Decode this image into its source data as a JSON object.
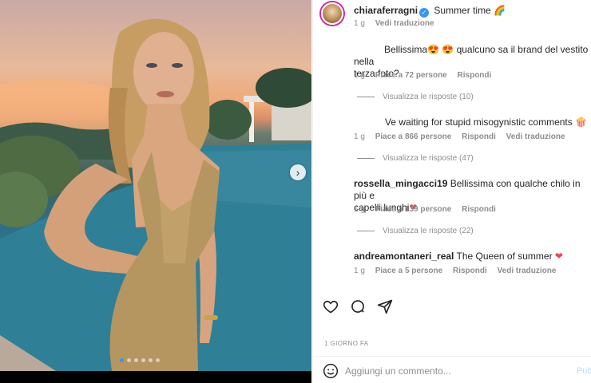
{
  "post": {
    "username": "chiaraferragni",
    "caption": "Summer time",
    "caption_emoji": "🌈",
    "age": "1 g",
    "translate": "Vedi traduzione",
    "timestamp": "1 GIORNO FA"
  },
  "comments": [
    {
      "text_prefix": "Bellissima",
      "emoji": "😍 😍",
      "text": "qualcuno sa il brand del vestito nella",
      "text_line2": "terza foto?",
      "age": "1 g",
      "likes": "Piace a 72 persone",
      "reply": "Rispondi",
      "view_replies": "Visualizza le risposte (10)"
    },
    {
      "text": "Ve waiting for stupid misogynistic comments",
      "emoji": "🍿",
      "age": "1 g",
      "likes": "Piace a 866 persone",
      "reply": "Rispondi",
      "translate": "Vedi traduzione",
      "view_replies": "Visualizza le risposte (47)"
    },
    {
      "username": "rossella_mingacci19",
      "text": "Bellissima con qualche chilo in più e",
      "text_line2": "capelli lunghi",
      "emoji": "❤",
      "age": "1 g",
      "likes": "Piace a 139 persone",
      "reply": "Rispondi",
      "view_replies": "Visualizza le risposte (22)"
    },
    {
      "username": "andreamontaneri_real",
      "text": "The Queen of summer",
      "emoji": "❤",
      "age": "1 g",
      "likes": "Piace a 5 persone",
      "reply": "Rispondi",
      "translate": "Vedi traduzione"
    }
  ],
  "composer": {
    "placeholder": "Aggiungi un commento...",
    "publish": "Pub"
  },
  "carousel": {
    "next_glyph": "›",
    "dots": 6,
    "active_dot": 0
  },
  "icons": {
    "avatar": "profile-avatar",
    "verified": "verified-badge-icon",
    "like": "heart-icon",
    "comment": "comment-bubble-icon",
    "share": "paper-plane-icon",
    "emoji": "smiley-icon",
    "next": "chevron-right-icon"
  },
  "colors": {
    "accent": "#3897f0",
    "muted": "#8e8e8e",
    "text": "#262626",
    "heart": "#ed4956"
  }
}
